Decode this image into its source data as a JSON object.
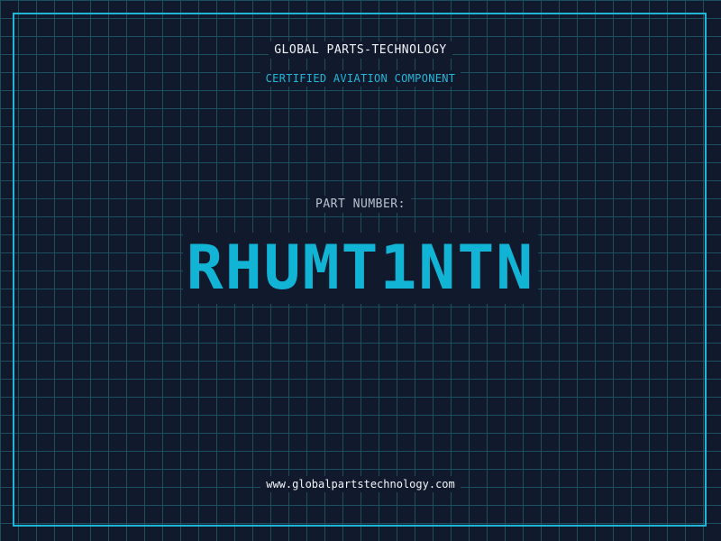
{
  "header": {
    "company": "GLOBAL PARTS-TECHNOLOGY",
    "subtitle": "CERTIFIED AVIATION COMPONENT"
  },
  "part": {
    "label": "PART NUMBER:",
    "number": "RHUMT1NTN"
  },
  "footer": {
    "website": "www.globalpartstechnology.com"
  },
  "colors": {
    "background": "#111a2c",
    "grid": "#1d4f5e",
    "accent": "#1fb6d8",
    "part_number": "#12b4d6",
    "text": "#f2f4f8",
    "muted": "#b9c2cf"
  }
}
